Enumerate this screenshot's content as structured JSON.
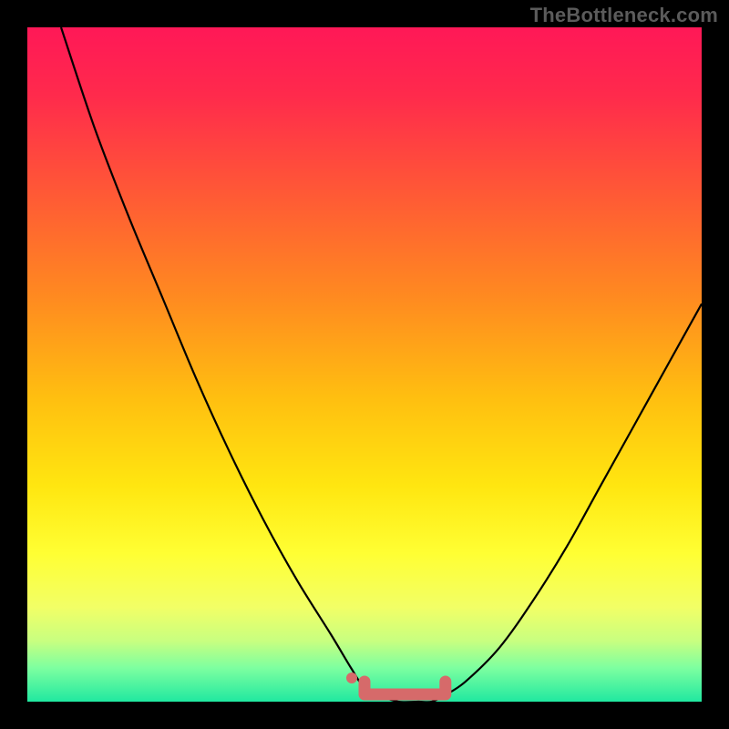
{
  "watermark": "TheBottleneck.com",
  "colors": {
    "frame": "#000000",
    "curve": "#000000",
    "marker": "#d66a6a",
    "gradient_stops": [
      {
        "offset": 0.0,
        "color": "#ff1857"
      },
      {
        "offset": 0.1,
        "color": "#ff2a4c"
      },
      {
        "offset": 0.25,
        "color": "#ff5a35"
      },
      {
        "offset": 0.4,
        "color": "#ff8a20"
      },
      {
        "offset": 0.55,
        "color": "#ffbf10"
      },
      {
        "offset": 0.68,
        "color": "#ffe610"
      },
      {
        "offset": 0.78,
        "color": "#ffff33"
      },
      {
        "offset": 0.86,
        "color": "#f2ff66"
      },
      {
        "offset": 0.91,
        "color": "#c8ff80"
      },
      {
        "offset": 0.95,
        "color": "#7dffa0"
      },
      {
        "offset": 1.0,
        "color": "#20e8a0"
      }
    ]
  },
  "chart_data": {
    "type": "line",
    "title": "",
    "xlabel": "",
    "ylabel": "",
    "xlim": [
      0,
      100
    ],
    "ylim": [
      0,
      100
    ],
    "x": [
      5,
      10,
      15,
      20,
      25,
      30,
      35,
      40,
      45,
      48,
      50,
      52,
      55,
      58,
      60,
      62,
      65,
      70,
      75,
      80,
      85,
      90,
      95,
      100
    ],
    "values": [
      100,
      85,
      72,
      60,
      48,
      37,
      27,
      18,
      10,
      5,
      2,
      1,
      0,
      0,
      0,
      1,
      3,
      8,
      15,
      23,
      32,
      41,
      50,
      59
    ],
    "marker_segment": {
      "x_start": 50,
      "x_end": 62,
      "y": 0
    },
    "annotations": []
  }
}
